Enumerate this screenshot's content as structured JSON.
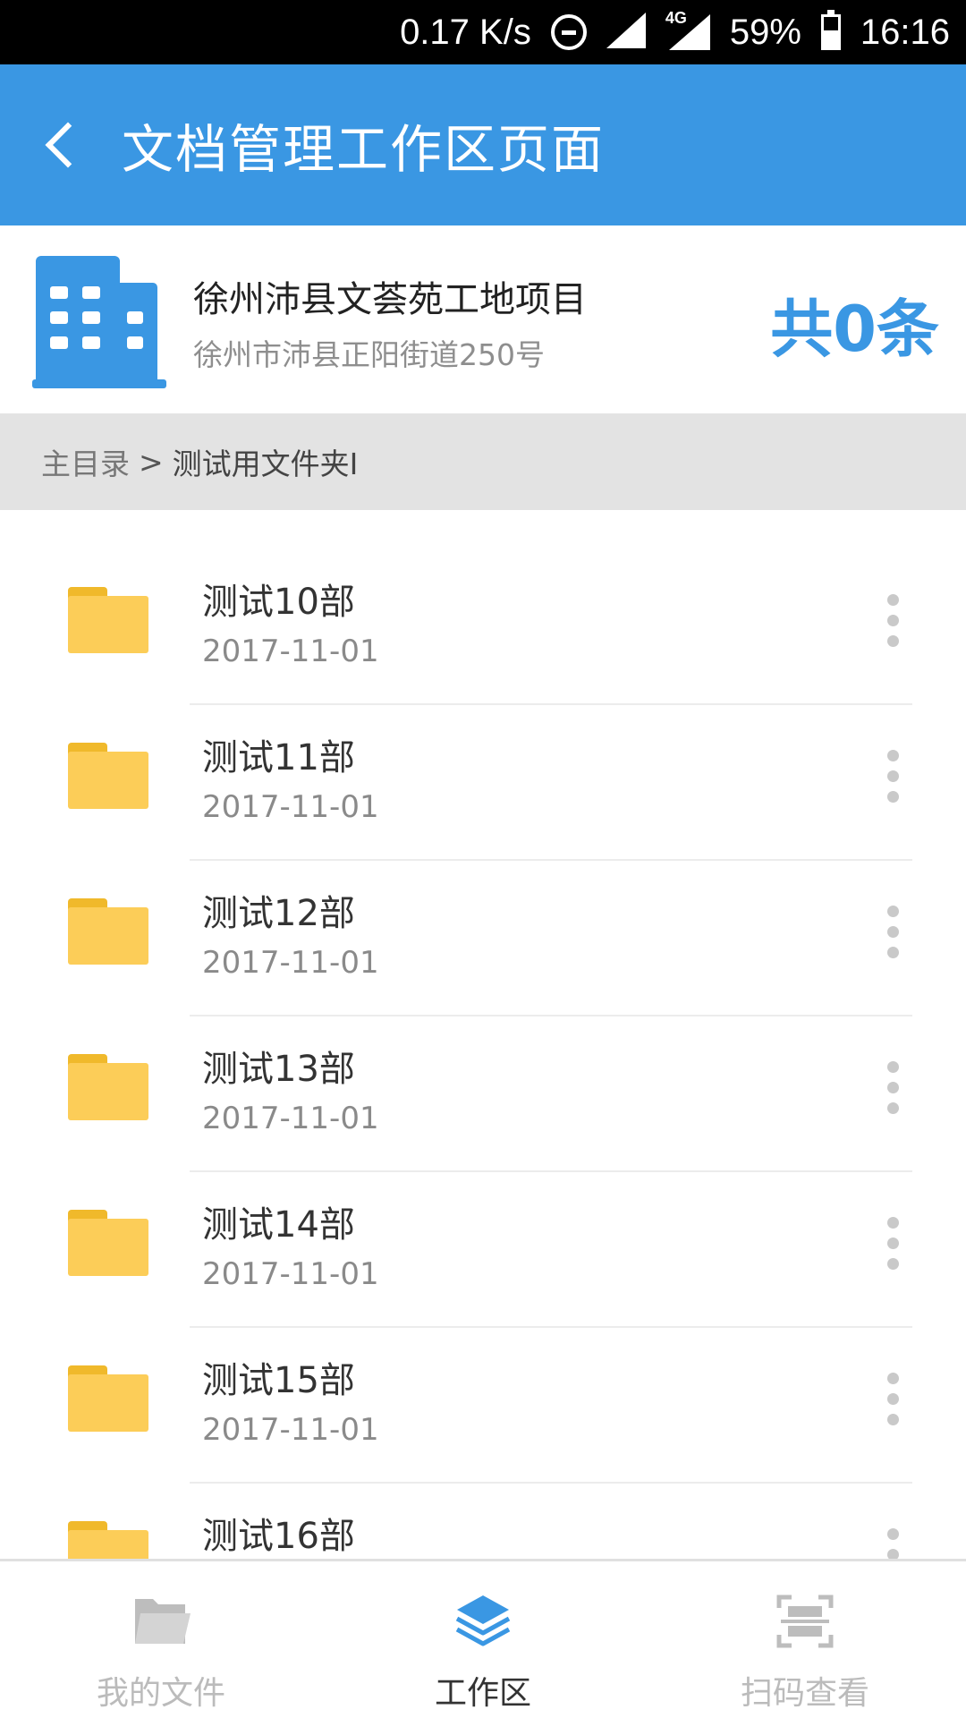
{
  "status_bar": {
    "speed": "0.17 K/s",
    "network": "4G",
    "battery": "59%",
    "time": "16:16"
  },
  "app_bar": {
    "title": "文档管理工作区页面"
  },
  "project": {
    "name": "徐州沛县文荟苑工地项目",
    "address": "徐州市沛县正阳街道250号",
    "count": "共0条"
  },
  "breadcrumb": {
    "root": "主目录",
    "separator": ">",
    "current": "测试用文件夹I"
  },
  "folders": [
    {
      "name": "测试10部",
      "date": "2017-11-01"
    },
    {
      "name": "测试11部",
      "date": "2017-11-01"
    },
    {
      "name": "测试12部",
      "date": "2017-11-01"
    },
    {
      "name": "测试13部",
      "date": "2017-11-01"
    },
    {
      "name": "测试14部",
      "date": "2017-11-01"
    },
    {
      "name": "测试15部",
      "date": "2017-11-01"
    },
    {
      "name": "测试16部",
      "date": ""
    }
  ],
  "bottom_nav": {
    "items": [
      {
        "label": "我的文件",
        "icon": "folder-icon",
        "active": false
      },
      {
        "label": "工作区",
        "icon": "layers-icon",
        "active": true
      },
      {
        "label": "扫码查看",
        "icon": "scan-icon",
        "active": false
      }
    ]
  },
  "colors": {
    "primary": "#3a97e3",
    "folder": "#fccd58",
    "inactive": "#bbbbbb"
  }
}
